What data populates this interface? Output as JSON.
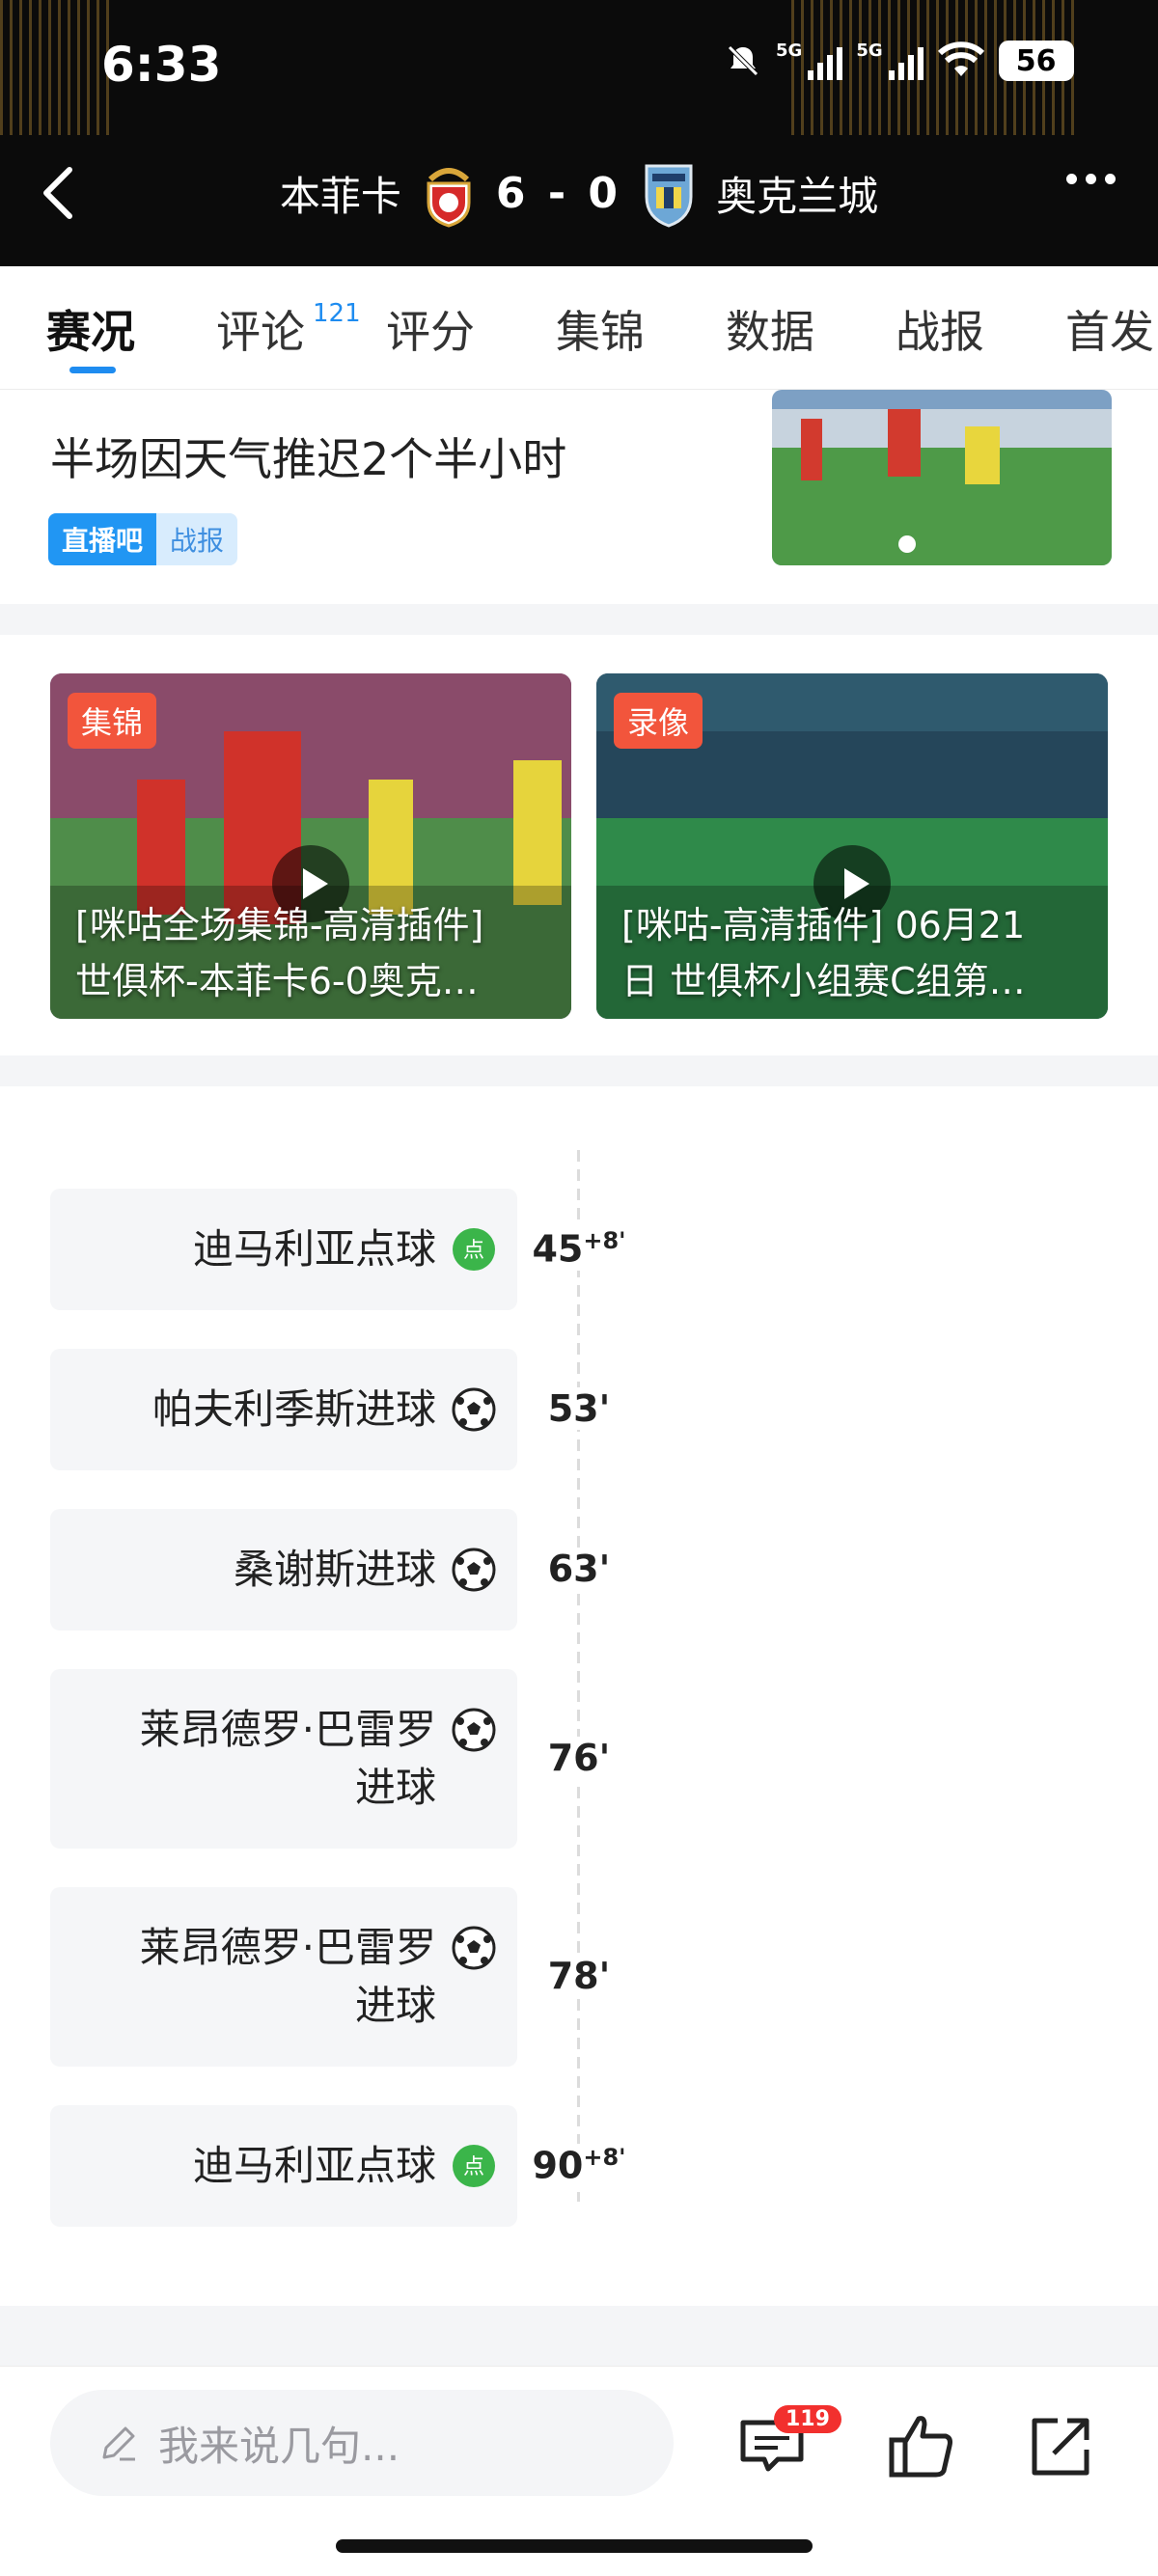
{
  "status_bar": {
    "time": "6:33",
    "battery": "56",
    "network_labels": [
      "5G",
      "5G"
    ]
  },
  "header": {
    "home_team": "本菲卡",
    "score": "6 - 0",
    "away_team": "奥克兰城",
    "home_crest_icon": "benfica-crest-icon",
    "away_crest_icon": "auckland-city-crest-icon"
  },
  "tabs": [
    {
      "label": "赛况",
      "active": true
    },
    {
      "label": "评论",
      "badge": "121"
    },
    {
      "label": "评分"
    },
    {
      "label": "集锦"
    },
    {
      "label": "数据"
    },
    {
      "label": "战报"
    },
    {
      "label": "首发"
    }
  ],
  "news": {
    "title_line2": "半场因天气推迟2个半小时",
    "tag_source": "直播吧",
    "tag_type": "战报"
  },
  "videos": [
    {
      "badge": "集锦",
      "title_line1": "[咪咕全场集锦-高清插件]",
      "title_line2": "世俱杯-本菲卡6-0奥克…"
    },
    {
      "badge": "录像",
      "title_line1": "[咪咕-高清插件] 06月21",
      "title_line2": "日 世俱杯小组赛C组第…"
    }
  ],
  "events": [
    {
      "text_line1": "迪马利亚点球",
      "text_line2": "",
      "icon": "penalty-icon",
      "minute": "45",
      "added": "+8'"
    },
    {
      "text_line1": "帕夫利季斯进球",
      "text_line2": "",
      "icon": "soccer-ball-icon",
      "minute": "53'",
      "added": ""
    },
    {
      "text_line1": "桑谢斯进球",
      "text_line2": "",
      "icon": "soccer-ball-icon",
      "minute": "63'",
      "added": ""
    },
    {
      "text_line1": "莱昂德罗·巴雷罗",
      "text_line2": "进球",
      "icon": "soccer-ball-icon",
      "minute": "76'",
      "added": ""
    },
    {
      "text_line1": "莱昂德罗·巴雷罗",
      "text_line2": "进球",
      "icon": "soccer-ball-icon",
      "minute": "78'",
      "added": ""
    },
    {
      "text_line1": "迪马利亚点球",
      "text_line2": "",
      "icon": "penalty-icon",
      "minute": "90",
      "added": "+8'"
    }
  ],
  "bottom_bar": {
    "comment_placeholder": "我来说几句...",
    "comment_count": "119"
  },
  "colors": {
    "accent": "#1e8cf0",
    "badge_red": "#f2553c",
    "penalty_green": "#3bb54a"
  }
}
